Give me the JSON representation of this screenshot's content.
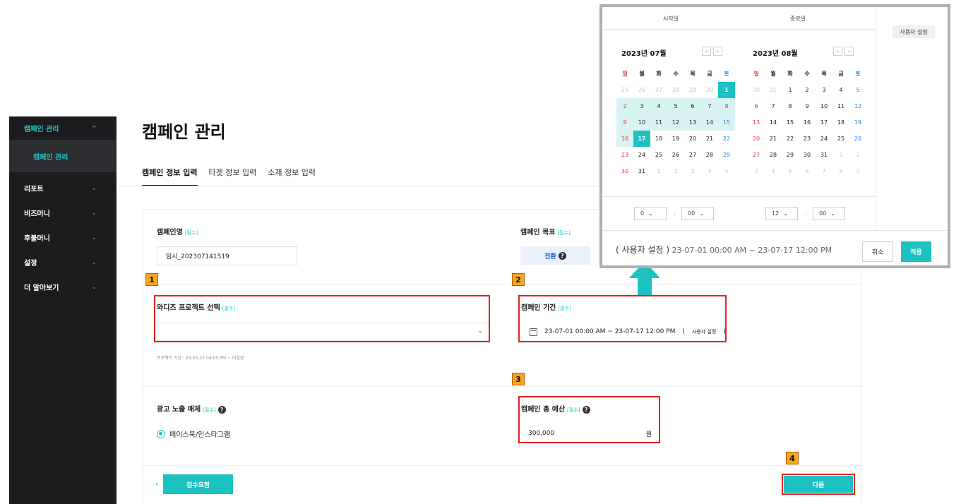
{
  "sidebar": {
    "items": [
      {
        "label": "캠페인 관리",
        "active": true
      },
      {
        "label": "리포트"
      },
      {
        "label": "비즈머니"
      },
      {
        "label": "후불머니"
      },
      {
        "label": "설정"
      },
      {
        "label": "더 알아보기"
      }
    ],
    "sub_item": "캠페인 관리",
    "chevron_up": "^",
    "chevron_down": "⌄"
  },
  "page": {
    "title": "캠페인 관리",
    "tabs": [
      "캠페인 정보 입력",
      "타겟 정보 입력",
      "소재 정보 입력"
    ]
  },
  "form": {
    "required": "[필수]",
    "campaign_name_label": "캠페인명",
    "campaign_name_value": "임시_202307141519",
    "campaign_goal_label": "캠페인 목표",
    "campaign_goal_value": "전환",
    "project_label": "와디즈 프로젝트 선택",
    "project_hint": "프로젝트 기간 : 23-03-27 04:00 PM ~ 미설정",
    "period_label": "캠페인 기간",
    "period_value": "23-07-01 00:00 AM ~ 23-07-17 12:00 PM",
    "period_mode": "사용자 설정",
    "paren_open": "(",
    "paren_close": ")",
    "media_label": "광고 노출 매체",
    "media_value": "페이스북/인스타그램",
    "budget_label": "캠페인 총 예산",
    "budget_value": "300,000",
    "budget_unit": "원",
    "review_button": "검수요청",
    "next_button": "다음",
    "help_glyph": "?"
  },
  "annotations": [
    "1",
    "2",
    "3",
    "4"
  ],
  "picker": {
    "start_label": "시작일",
    "end_label": "종료일",
    "custom_tag": "사용자 설정",
    "nav_prev": "‹",
    "nav_next": "›",
    "weekdays": [
      "일",
      "월",
      "화",
      "수",
      "목",
      "금",
      "토"
    ],
    "months": [
      {
        "title": "2023년 07월",
        "days": [
          "25",
          "26",
          "27",
          "28",
          "29",
          "30",
          "1",
          "2",
          "3",
          "4",
          "5",
          "6",
          "7",
          "8",
          "9",
          "10",
          "11",
          "12",
          "13",
          "14",
          "15",
          "16",
          "17",
          "18",
          "19",
          "20",
          "21",
          "22",
          "23",
          "24",
          "25",
          "26",
          "27",
          "28",
          "29",
          "30",
          "31",
          "1",
          "2",
          "3",
          "4",
          "5"
        ]
      },
      {
        "title": "2023년 08월",
        "days": [
          "30",
          "31",
          "1",
          "2",
          "3",
          "4",
          "5",
          "6",
          "7",
          "8",
          "9",
          "10",
          "11",
          "12",
          "13",
          "14",
          "15",
          "16",
          "17",
          "18",
          "19",
          "20",
          "21",
          "22",
          "23",
          "24",
          "25",
          "26",
          "27",
          "28",
          "29",
          "30",
          "31",
          "1",
          "2",
          "3",
          "4",
          "5",
          "6",
          "7",
          "8",
          "9"
        ]
      }
    ],
    "time": {
      "start_hour": "0",
      "start_min": "00",
      "end_hour": "12",
      "end_min": "00",
      "colon": ":"
    },
    "summary_mode": "( 사용자 설정 )",
    "summary_range": "23-07-01 00:00 AM ~ 23-07-17 12:00 PM",
    "cancel": "취소",
    "apply": "적용"
  },
  "colors": {
    "accent": "#1cc2c2",
    "annotation_box": "#e4201f",
    "annotation_tag": "#f5a623",
    "sidebar_bg": "#1c1c1e"
  }
}
